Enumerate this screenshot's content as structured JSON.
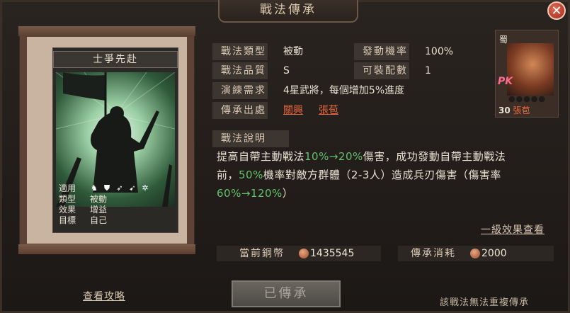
{
  "window": {
    "title": "戰法傳承",
    "close_label": "✕"
  },
  "tactic_card": {
    "name": "士爭先赴",
    "rows": [
      {
        "key": "適用",
        "value": ""
      },
      {
        "key": "類型",
        "value": "被動"
      },
      {
        "key": "效果",
        "value": "增益"
      },
      {
        "key": "目標",
        "value": "自己"
      }
    ],
    "applicable_icons": [
      "cavalry-icon",
      "shield-icon",
      "bow-icon",
      "spear-icon",
      "wheel-icon"
    ]
  },
  "info": {
    "type_label": "戰法類型",
    "type_value": "被動",
    "rate_label": "發動機率",
    "rate_value": "100%",
    "quality_label": "戰法品質",
    "quality_value": "S",
    "slots_label": "可裝配數",
    "slots_value": "1",
    "train_label": "演練需求",
    "train_value": "4星武將，每個增加5%進度",
    "source_label": "傳承出處",
    "source_values": [
      "關興",
      "張苞"
    ]
  },
  "general": {
    "faction": "蜀",
    "pk_badge": "PK",
    "level": "30",
    "name": "張苞",
    "stars_count": 5
  },
  "description": {
    "title": "戰法說明",
    "line1_a": "提高自帶主動戰法",
    "line1_hl": "10%→20%",
    "line1_b": "傷害，成功發動自帶主動戰法",
    "line2_a": "前，",
    "line2_hl": "50%",
    "line2_b": "機率對敵方群體（2-3人）造成兵刃傷害（傷害率",
    "line3_hl": "60%→120%",
    "line3_b": "）"
  },
  "level_effect_link": "一級效果查看",
  "bottom": {
    "copper_label": "當前銅幣",
    "copper_value": "1435545",
    "cost_label": "傳承消耗",
    "cost_value": "2000",
    "guide_link": "查看攻略",
    "inherit_button": "已傳承",
    "note": "該戰法無法重複傳承"
  },
  "colors": {
    "accent_link": "#e7663f",
    "highlight": "#62c16a",
    "text": "#e8e0d2"
  }
}
